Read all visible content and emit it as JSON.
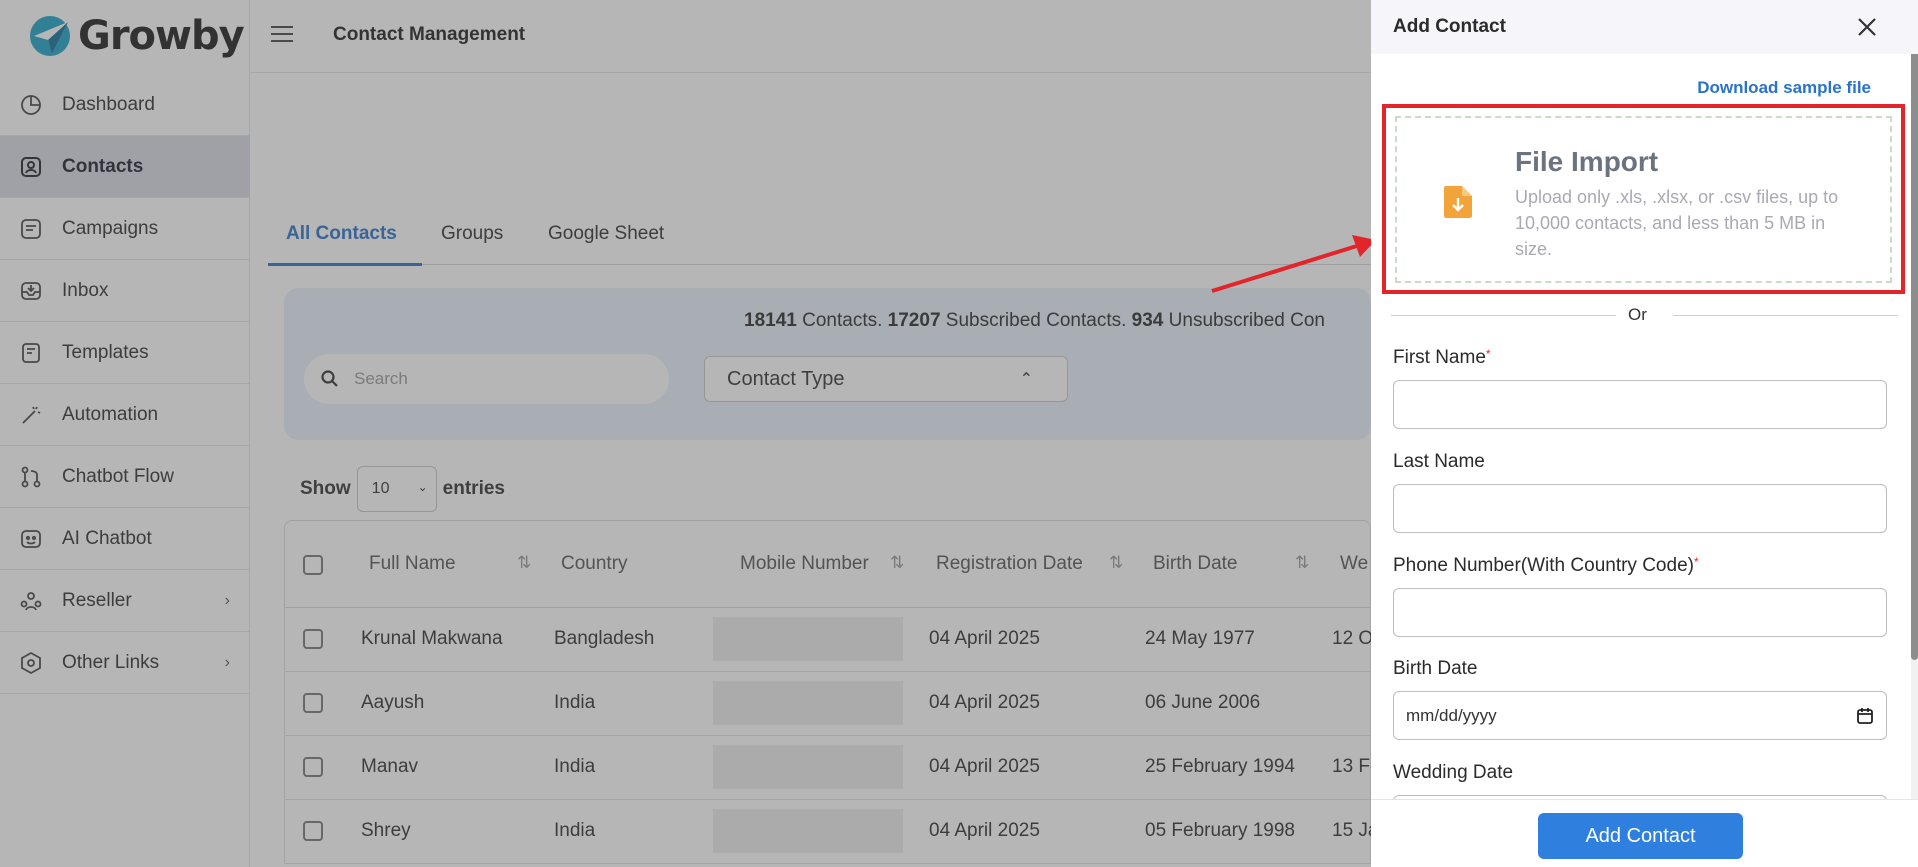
{
  "brand": {
    "name": "Growby",
    "accent": "#2a73c9"
  },
  "sidebar": {
    "items": [
      {
        "label": "Dashboard",
        "icon": "dashboard-icon"
      },
      {
        "label": "Contacts",
        "icon": "contact-icon",
        "active": true
      },
      {
        "label": "Campaigns",
        "icon": "campaign-icon"
      },
      {
        "label": "Inbox",
        "icon": "inbox-icon"
      },
      {
        "label": "Templates",
        "icon": "template-icon"
      },
      {
        "label": "Automation",
        "icon": "wand-icon"
      },
      {
        "label": "Chatbot Flow",
        "icon": "flow-icon"
      },
      {
        "label": "AI Chatbot",
        "icon": "bot-icon"
      },
      {
        "label": "Reseller",
        "icon": "reseller-icon",
        "has_submenu": true
      },
      {
        "label": "Other Links",
        "icon": "links-icon",
        "has_submenu": true
      }
    ]
  },
  "header": {
    "title": "Contact Management"
  },
  "tabs": [
    "All Contacts",
    "Groups",
    "Google Sheet"
  ],
  "summary": {
    "contacts": "18141",
    "contacts_label": "Contacts.",
    "subscribed": "17207",
    "subscribed_label": "Subscribed Contacts.",
    "unsubscribed": "934",
    "unsubscribed_label": "Unsubscribed Con"
  },
  "search": {
    "placeholder": "Search"
  },
  "contact_type": {
    "label": "Contact Type"
  },
  "entries": {
    "show": "Show",
    "value": "10",
    "suffix": "entries"
  },
  "table": {
    "columns": [
      "Full Name",
      "Country",
      "Mobile Number",
      "Registration Date",
      "Birth Date",
      "We"
    ],
    "rows": [
      {
        "name": "Krunal Makwana",
        "country": "Bangladesh",
        "registration": "04 April 2025",
        "birth": "24 May 1977",
        "wedding": "12 O"
      },
      {
        "name": "Aayush",
        "country": "India",
        "registration": "04 April 2025",
        "birth": "06 June 2006",
        "wedding": ""
      },
      {
        "name": "Manav",
        "country": "India",
        "registration": "04 April 2025",
        "birth": "25 February 1994",
        "wedding": "13 Fe"
      },
      {
        "name": "Shrey",
        "country": "India",
        "registration": "04 April 2025",
        "birth": "05 February 1998",
        "wedding": "15 Ja"
      }
    ]
  },
  "drawer": {
    "title": "Add Contact",
    "download_link": "Download sample file",
    "import_title": "File Import",
    "import_desc": "Upload only .xls, .xlsx, or .csv files, up to 10,000 contacts, and less than 5 MB in size.",
    "or": "Or",
    "first_name": "First Name",
    "last_name": "Last Name",
    "phone": "Phone Number(With Country Code)",
    "birth_date": "Birth Date",
    "date_placeholder": "mm/dd/yyyy",
    "wedding_date": "Wedding Date",
    "submit": "Add Contact"
  }
}
